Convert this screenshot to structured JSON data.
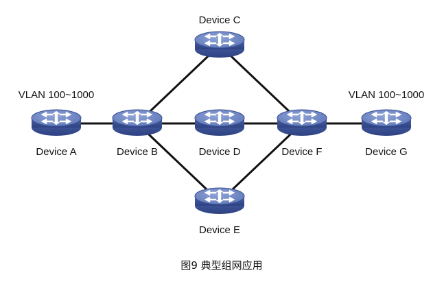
{
  "diagram": {
    "devices": [
      {
        "id": "A",
        "label": "Device A",
        "note": "VLAN 100~1000"
      },
      {
        "id": "B",
        "label": "Device B"
      },
      {
        "id": "C",
        "label": "Device C"
      },
      {
        "id": "D",
        "label": "Device D"
      },
      {
        "id": "E",
        "label": "Device E"
      },
      {
        "id": "F",
        "label": "Device F"
      },
      {
        "id": "G",
        "label": "Device G",
        "note": "VLAN 100~1000"
      }
    ],
    "links": [
      [
        "A",
        "B"
      ],
      [
        "B",
        "C"
      ],
      [
        "B",
        "D"
      ],
      [
        "B",
        "E"
      ],
      [
        "C",
        "F"
      ],
      [
        "D",
        "F"
      ],
      [
        "E",
        "F"
      ],
      [
        "F",
        "G"
      ]
    ],
    "caption": "图9 典型组网应用"
  },
  "colors": {
    "switch_top": "#6f86c4",
    "switch_side": "#3f5596",
    "switch_rim": "#2c3f78",
    "link": "#111111"
  }
}
